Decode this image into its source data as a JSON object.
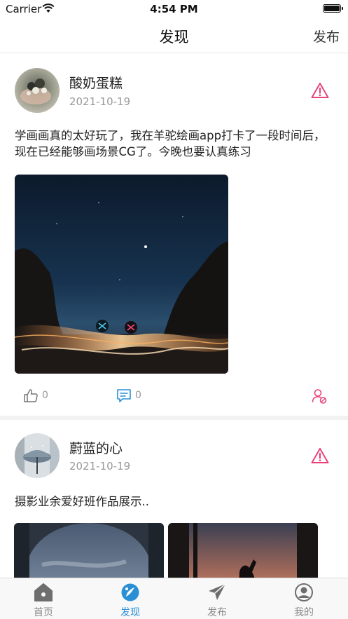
{
  "status_bar": {
    "carrier": "Carrier",
    "time": "4:54 PM"
  },
  "nav": {
    "title": "发现",
    "action": "发布"
  },
  "posts": [
    {
      "author": "酸奶蛋糕",
      "date": "2021-10-19",
      "text": "学画画真的太好玩了，我在羊驼绘画app打卡了一段时间后，现在已经能够画场景CG了。今晚也要认真练习",
      "likes": "0",
      "comments": "0"
    },
    {
      "author": "蔚蓝的心",
      "date": "2021-10-19",
      "text": "摄影业余爱好班作品展示.."
    }
  ],
  "tabs": [
    {
      "label": "首页",
      "icon": "home-icon"
    },
    {
      "label": "发现",
      "icon": "discover-icon",
      "active": true
    },
    {
      "label": "发布",
      "icon": "send-icon"
    },
    {
      "label": "我的",
      "icon": "profile-icon"
    }
  ],
  "colors": {
    "accent": "#2b8fd6",
    "warning": "#e8437a",
    "muted": "#999999"
  }
}
